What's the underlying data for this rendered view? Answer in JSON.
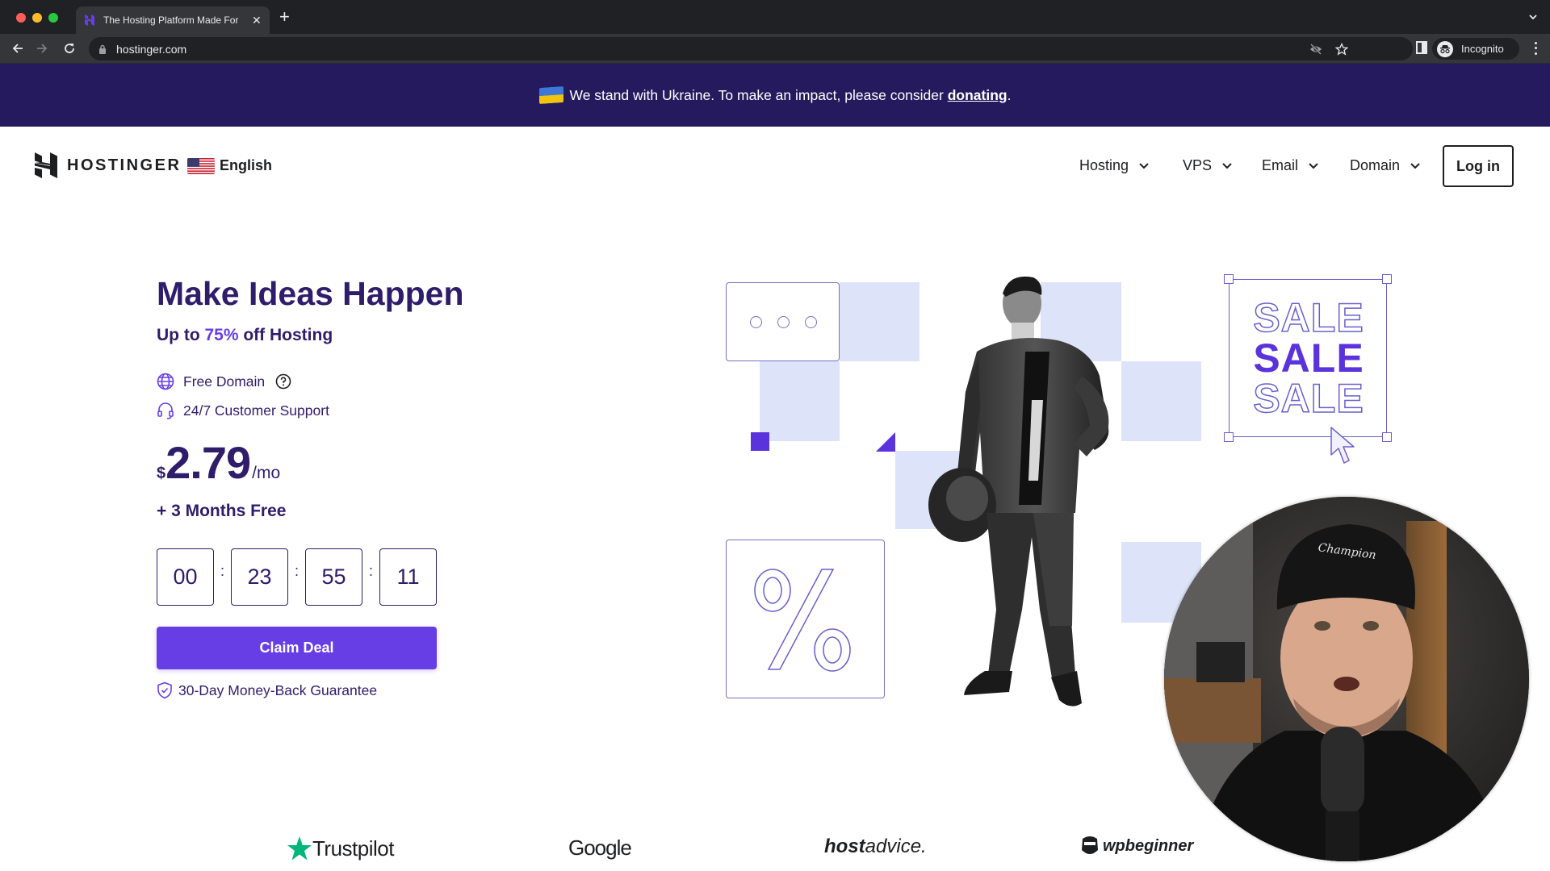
{
  "browser": {
    "tab_title": "The Hosting Platform Made For",
    "url": "hostinger.com",
    "profile_label": "Incognito"
  },
  "banner": {
    "text": "We stand with Ukraine. To make an impact, please consider ",
    "link_label": "donating",
    "suffix": "."
  },
  "header": {
    "brand": "HOSTINGER",
    "language": "English",
    "menu": [
      {
        "label": "Hosting"
      },
      {
        "label": "VPS"
      },
      {
        "label": "Email"
      },
      {
        "label": "Domain"
      }
    ],
    "login_label": "Log in"
  },
  "hero": {
    "title": "Make Ideas Happen",
    "subtitle_prefix": "Up to ",
    "subtitle_accent": "75%",
    "subtitle_suffix": " off Hosting",
    "features": [
      {
        "icon": "globe-icon",
        "label": "Free Domain"
      },
      {
        "icon": "headset-icon",
        "label": "24/7 Customer Support"
      }
    ],
    "price": {
      "currency": "$",
      "amount": "2.79",
      "period": "/mo"
    },
    "bonus": "+ 3 Months Free",
    "countdown": [
      "00",
      "23",
      "55",
      "11"
    ],
    "countdown_separator": ":",
    "cta_label": "Claim Deal",
    "guarantee": "30-Day Money-Back Guarantee"
  },
  "illustration": {
    "sale_words": [
      "SALE",
      "SALE",
      "SALE"
    ],
    "percent_symbol": "%"
  },
  "reviews": [
    {
      "name": "Trustpilot"
    },
    {
      "name": "Google"
    },
    {
      "name_bold": "host",
      "name_thin": "advice."
    },
    {
      "name": "wpbeginner"
    }
  ],
  "colors": {
    "brand_purple": "#673de6",
    "banner_bg": "#261a5e",
    "heading_navy": "#2f1c6a",
    "deco_light": "#dde3f8",
    "trustpilot_green": "#00b67a"
  }
}
